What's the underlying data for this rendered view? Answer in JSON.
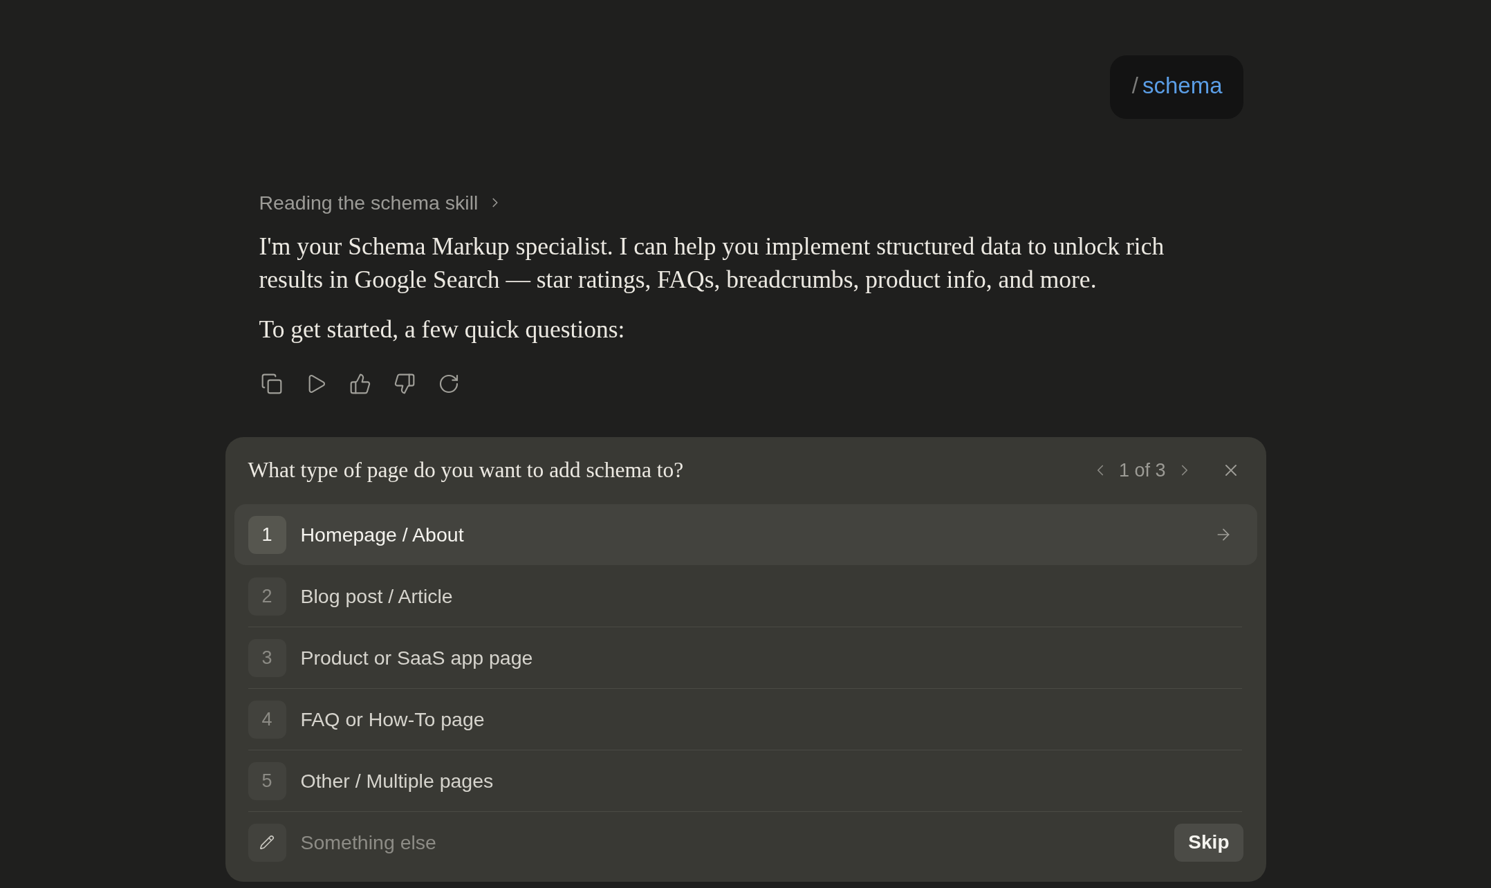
{
  "command_bubble": {
    "slash": "/",
    "command": "schema"
  },
  "assistant_message": {
    "skill_status": "Reading the schema skill",
    "paragraphs": [
      "I'm your Schema Markup specialist. I can help you implement structured data to unlock rich results in Google Search — star ratings, FAQs, breadcrumbs, product info, and more.",
      "To get started, a few quick questions:"
    ]
  },
  "question_card": {
    "question": "What type of page do you want to add schema to?",
    "pager": "1 of 3",
    "options": [
      {
        "number": "1",
        "label": "Homepage / About",
        "selected": true
      },
      {
        "number": "2",
        "label": "Blog post / Article",
        "selected": false
      },
      {
        "number": "3",
        "label": "Product or SaaS app page",
        "selected": false
      },
      {
        "number": "4",
        "label": "FAQ or How-To page",
        "selected": false
      },
      {
        "number": "5",
        "label": "Other / Multiple pages",
        "selected": false
      }
    ],
    "other_answer": {
      "placeholder": "Something else"
    },
    "skip_button": "Skip"
  }
}
